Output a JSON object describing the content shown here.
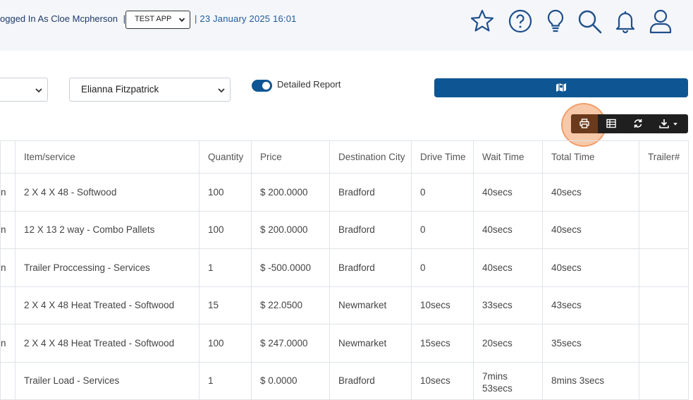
{
  "header": {
    "login_text": "ogged In As Cloe Mcpherson",
    "separator": "|",
    "app_select_value": "TEST APP",
    "datetime": "| 23 January 2025 16:01",
    "icons": [
      "star-icon",
      "help-icon",
      "lightbulb-icon",
      "search-icon",
      "bell-icon",
      "user-icon"
    ]
  },
  "filters": {
    "driver_select_value": "Elianna Fitzpatrick",
    "detailed_report_label": "Detailed Report",
    "detailed_report_on": true
  },
  "toolbar": {
    "icons": [
      "print-icon",
      "table-icon",
      "refresh-icon",
      "download-icon"
    ]
  },
  "table": {
    "columns": [
      "",
      "Item/service",
      "Quantity",
      "Price",
      "Destination City",
      "Drive Time",
      "Wait Time",
      "Total Time",
      "Trailer#"
    ],
    "rows": [
      [
        "n",
        "2 X 4 X 48 - Softwood",
        "100",
        "$ 200.0000",
        "Bradford",
        "0",
        "40secs",
        "40secs",
        ""
      ],
      [
        "n",
        "12 X 13 2 way - Combo Pallets",
        "100",
        "$ 200.0000",
        "Bradford",
        "0",
        "40secs",
        "40secs",
        ""
      ],
      [
        "n",
        "Trailer Proccessing - Services",
        "1",
        "$ -500.0000",
        "Bradford",
        "0",
        "40secs",
        "40secs",
        ""
      ],
      [
        "",
        "2 X 4 X 48 Heat Treated - Softwood",
        "15",
        "$ 22.0500",
        "Newmarket",
        "10secs",
        "33secs",
        "43secs",
        ""
      ],
      [
        "n",
        "2 X 4 X 48 Heat Treated - Softwood",
        "100",
        "$ 247.0000",
        "Newmarket",
        "15secs",
        "20secs",
        "35secs",
        ""
      ],
      [
        "",
        "Trailer Load - Services",
        "1",
        "$ 0.0000",
        "Bradford",
        "10secs",
        "7mins 53secs",
        "8mins 3secs",
        ""
      ]
    ]
  },
  "colors": {
    "brand_blue": "#0e5693",
    "header_bg": "#f4f6fa",
    "toolbar_bg": "#1f1f1f",
    "highlight": "#f39c60"
  }
}
